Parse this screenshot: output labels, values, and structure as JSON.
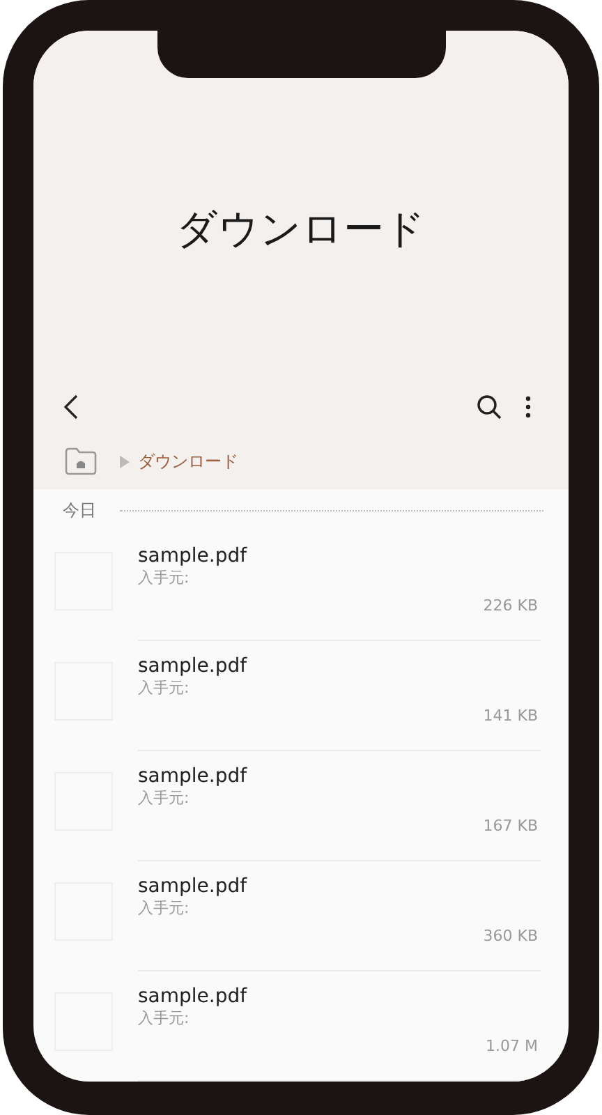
{
  "header": {
    "title": "ダウンロード"
  },
  "toolbar": {
    "breadcrumb": "ダウンロード"
  },
  "section": {
    "label": "今日"
  },
  "files": [
    {
      "name": "sample.pdf",
      "source": "入手元:",
      "size": "226 KB"
    },
    {
      "name": "sample.pdf",
      "source": "入手元:",
      "size": "141 KB"
    },
    {
      "name": "sample.pdf",
      "source": "入手元:",
      "size": "167 KB"
    },
    {
      "name": "sample.pdf",
      "source": "入手元:",
      "size": "360 KB"
    },
    {
      "name": "sample.pdf",
      "source": "入手元:",
      "size": "1.07 M"
    }
  ]
}
